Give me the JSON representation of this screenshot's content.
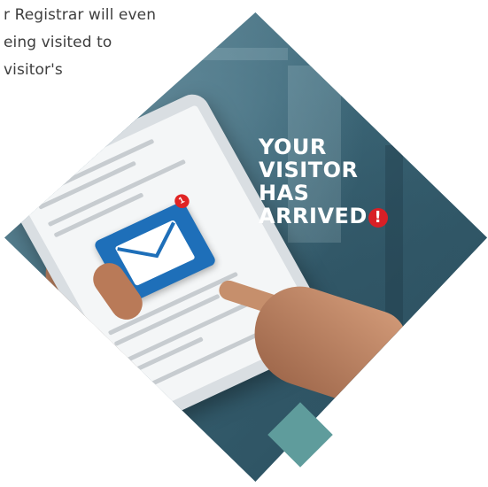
{
  "intro_text": {
    "line1": "r Registrar will even",
    "line2": "eing visited to",
    "line3": "visitor's"
  },
  "image": {
    "headline": [
      "YOUR",
      "VISITOR",
      "HAS",
      "ARRIVED"
    ],
    "exclamation": "!",
    "notification_badge": "1",
    "colors": {
      "diamond": "#3f6a7b",
      "mail_tile": "#1e6fb9",
      "alert": "#d81f26",
      "accent_square": "#5f9c9c"
    },
    "icons": [
      "envelope-icon",
      "notification-badge",
      "exclamation-badge"
    ]
  }
}
